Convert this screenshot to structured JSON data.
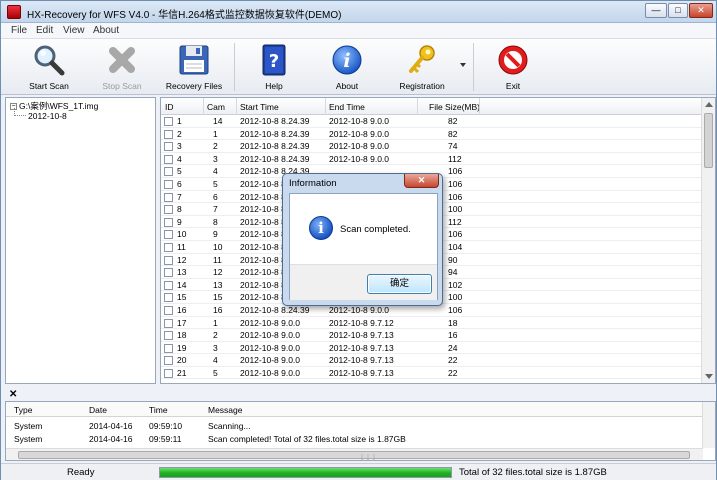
{
  "window": {
    "title": "HX-Recovery for WFS  V4.0  - 华信H.264格式监控数据恢复软件(DEMO)",
    "controls": {
      "minimize": "—",
      "maximize": "□",
      "close": "✕"
    }
  },
  "menu": [
    "File",
    "Edit",
    "View",
    "About"
  ],
  "toolbar": {
    "start_scan": "Start Scan",
    "stop_scan": "Stop Scan",
    "recovery_files": "Recovery  Files",
    "help": "Help",
    "about": "About",
    "registration": "Registration",
    "exit": "Exit"
  },
  "icons": {
    "start_scan": "magnifier-icon",
    "stop_scan": "stop-cross-icon",
    "recovery_files": "floppy-disk-icon",
    "help": "help-book-icon",
    "about": "info-icon",
    "registration": "key-icon",
    "exit": "exit-no-entry-icon"
  },
  "tree": {
    "root": "G:\\案例\\WFS_1T.img",
    "child": "2012-10-8"
  },
  "table": {
    "headers": [
      "ID",
      "Cam",
      "Start Time",
      "End Time",
      "File Size(MB)"
    ],
    "rows": [
      {
        "id": "1",
        "cam": "14",
        "start": "2012-10-8 8.24.39",
        "end": "2012-10-8 9.0.0",
        "size": "82"
      },
      {
        "id": "2",
        "cam": "1",
        "start": "2012-10-8 8.24.39",
        "end": "2012-10-8 9.0.0",
        "size": "82"
      },
      {
        "id": "3",
        "cam": "2",
        "start": "2012-10-8 8.24.39",
        "end": "2012-10-8 9.0.0",
        "size": "74"
      },
      {
        "id": "4",
        "cam": "3",
        "start": "2012-10-8 8.24.39",
        "end": "2012-10-8 9.0.0",
        "size": "112"
      },
      {
        "id": "5",
        "cam": "4",
        "start": "2012-10-8 8.24.39",
        "end": "",
        "size": "106"
      },
      {
        "id": "6",
        "cam": "5",
        "start": "2012-10-8 8.24.39",
        "end": "",
        "size": "106"
      },
      {
        "id": "7",
        "cam": "6",
        "start": "2012-10-8 8.24.39",
        "end": "",
        "size": "106"
      },
      {
        "id": "8",
        "cam": "7",
        "start": "2012-10-8 8.24.39",
        "end": "",
        "size": "100"
      },
      {
        "id": "9",
        "cam": "8",
        "start": "2012-10-8 8.24.39",
        "end": "",
        "size": "112"
      },
      {
        "id": "10",
        "cam": "9",
        "start": "2012-10-8 8.24.39",
        "end": "",
        "size": "106"
      },
      {
        "id": "11",
        "cam": "10",
        "start": "2012-10-8 8.24.39",
        "end": "",
        "size": "104"
      },
      {
        "id": "12",
        "cam": "11",
        "start": "2012-10-8 8.24.39",
        "end": "",
        "size": "90"
      },
      {
        "id": "13",
        "cam": "12",
        "start": "2012-10-8 8.24.39",
        "end": "",
        "size": "94"
      },
      {
        "id": "14",
        "cam": "13",
        "start": "2012-10-8 8.24.39",
        "end": "",
        "size": "102"
      },
      {
        "id": "15",
        "cam": "15",
        "start": "2012-10-8 8.24.39",
        "end": "",
        "size": "100"
      },
      {
        "id": "16",
        "cam": "16",
        "start": "2012-10-8 8.24.39",
        "end": "2012-10-8 9.0.0",
        "size": "106"
      },
      {
        "id": "17",
        "cam": "1",
        "start": "2012-10-8 9.0.0",
        "end": "2012-10-8 9.7.12",
        "size": "18"
      },
      {
        "id": "18",
        "cam": "2",
        "start": "2012-10-8 9.0.0",
        "end": "2012-10-8 9.7.13",
        "size": "16"
      },
      {
        "id": "19",
        "cam": "3",
        "start": "2012-10-8 9.0.0",
        "end": "2012-10-8 9.7.13",
        "size": "24"
      },
      {
        "id": "20",
        "cam": "4",
        "start": "2012-10-8 9.0.0",
        "end": "2012-10-8 9.7.13",
        "size": "22"
      },
      {
        "id": "21",
        "cam": "5",
        "start": "2012-10-8 9.0.0",
        "end": "2012-10-8 9.7.13",
        "size": "22"
      }
    ]
  },
  "log": {
    "close_glyph": "✕",
    "headers": [
      "Type",
      "Date",
      "Time",
      "Message"
    ],
    "rows": [
      {
        "type": "System",
        "date": "2014-04-16",
        "time": "09:59:10",
        "message": "Scanning..."
      },
      {
        "type": "System",
        "date": "2014-04-16",
        "time": "09:59:11",
        "message": "Scan completed! Total of 32 files.total size is 1.87GB"
      }
    ]
  },
  "status": {
    "ready": "Ready",
    "progress": 1.0,
    "total": "Total of 32 files.total size is 1.87GB"
  },
  "dialog": {
    "title": "Information",
    "close": "✕",
    "icon_glyph": "i",
    "message": "Scan completed.",
    "ok": "确定"
  },
  "colors": {
    "progress": "#20b022",
    "dialog_frame": "#c9d9ee",
    "info_icon": "#1a56c6"
  }
}
